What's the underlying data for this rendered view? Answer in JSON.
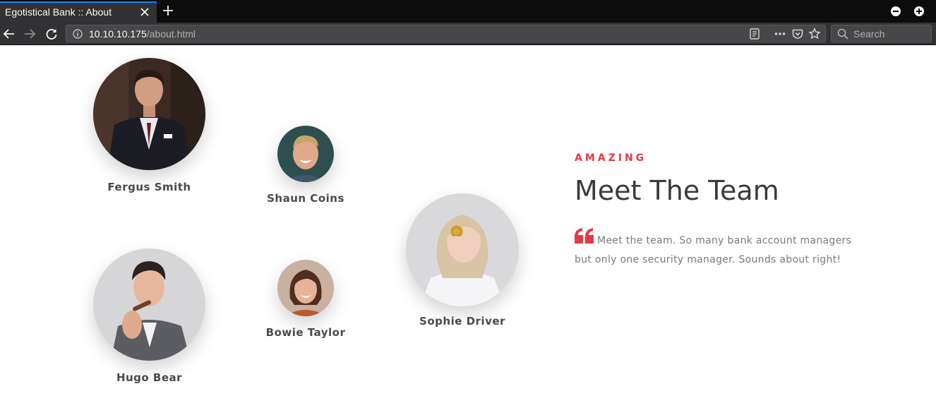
{
  "browser": {
    "tab_title": "Egotistical Bank :: About",
    "url_host": "10.10.10.175",
    "url_path": "/about.html",
    "search_placeholder": "Search"
  },
  "team": {
    "eyebrow": "AMAZING",
    "heading": "Meet The Team",
    "description": "Meet the team. So many bank account managers but only one security manager. Sounds about right!",
    "accent_color": "#e63946",
    "members": [
      {
        "name": "Fergus Smith"
      },
      {
        "name": "Shaun Coins"
      },
      {
        "name": "Sophie Driver"
      },
      {
        "name": "Hugo Bear"
      },
      {
        "name": "Bowie Taylor"
      }
    ]
  }
}
